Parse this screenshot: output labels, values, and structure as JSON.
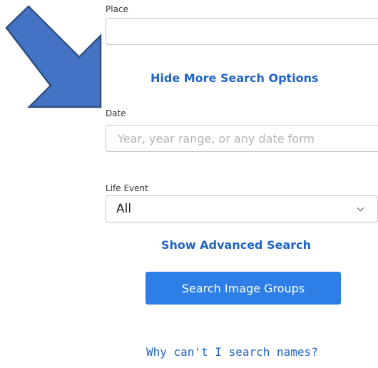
{
  "place": {
    "label": "Place",
    "value": ""
  },
  "more_options_link": "Hide More Search Options",
  "date": {
    "label": "Date",
    "placeholder": "Year, year range, or any date form"
  },
  "life_event": {
    "label": "Life Event",
    "selected": "All"
  },
  "advanced_link": "Show Advanced Search",
  "search_button": "Search Image Groups",
  "help_link": "Why can't I search names?",
  "colors": {
    "link": "#1f63c6",
    "button": "#2d7ee6",
    "arrow_fill": "#4472c4",
    "arrow_stroke": "#2f4f80"
  }
}
